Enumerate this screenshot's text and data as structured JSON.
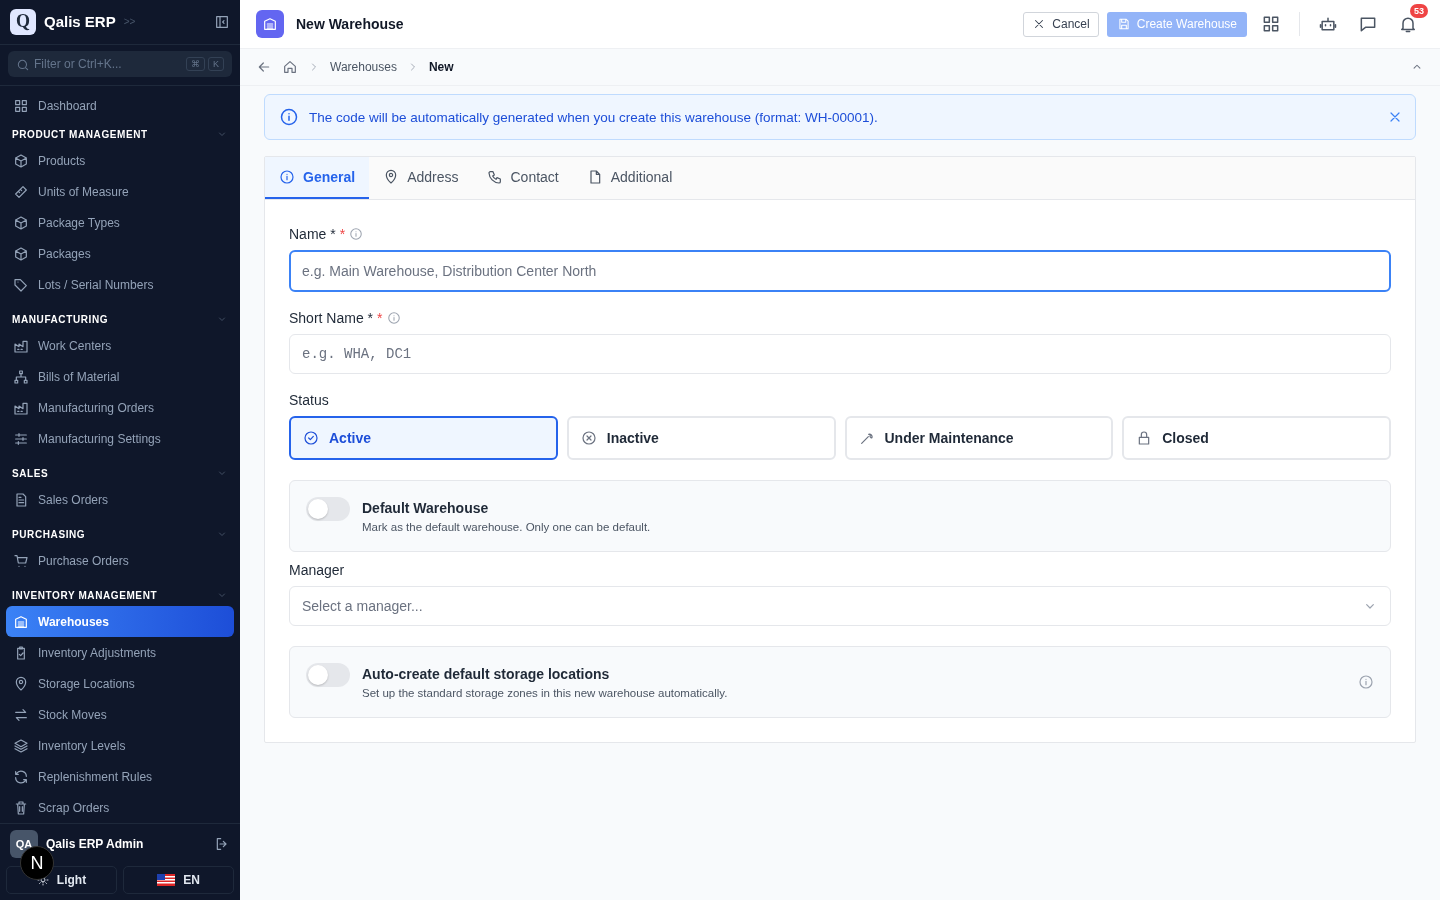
{
  "sidebar": {
    "brand": {
      "logo": "Q",
      "name": "Qalis ERP",
      "expand": ">>"
    },
    "search": {
      "placeholder": "Filter or Ctrl+K...",
      "keys": [
        "⌘",
        "K"
      ]
    },
    "top_item": {
      "label": "Dashboard",
      "selected": false
    },
    "sections": [
      {
        "title": "PRODUCT MANAGEMENT",
        "expanded": true,
        "items": [
          {
            "label": "Products",
            "selected": false
          },
          {
            "label": "Units of Measure",
            "selected": false
          },
          {
            "label": "Package Types",
            "selected": false
          },
          {
            "label": "Packages",
            "selected": false
          },
          {
            "label": "Lots / Serial Numbers",
            "selected": false
          }
        ]
      },
      {
        "title": "MANUFACTURING",
        "expanded": true,
        "items": [
          {
            "label": "Work Centers",
            "selected": false
          },
          {
            "label": "Bills of Material",
            "selected": false
          },
          {
            "label": "Manufacturing Orders",
            "selected": false
          },
          {
            "label": "Manufacturing Settings",
            "selected": false
          }
        ]
      },
      {
        "title": "SALES",
        "expanded": true,
        "items": [
          {
            "label": "Sales Orders",
            "selected": false
          }
        ]
      },
      {
        "title": "PURCHASING",
        "expanded": true,
        "items": [
          {
            "label": "Purchase Orders",
            "selected": false
          }
        ]
      },
      {
        "title": "INVENTORY MANAGEMENT",
        "expanded": true,
        "items": [
          {
            "label": "Warehouses",
            "selected": true
          },
          {
            "label": "Inventory Adjustments",
            "selected": false
          },
          {
            "label": "Storage Locations",
            "selected": false
          },
          {
            "label": "Stock Moves",
            "selected": false
          },
          {
            "label": "Inventory Levels",
            "selected": false
          },
          {
            "label": "Replenishment Rules",
            "selected": false
          },
          {
            "label": "Scrap Orders",
            "selected": false
          }
        ]
      }
    ],
    "user": {
      "initials": "QA",
      "name": "Qalis ERP Admin"
    },
    "dev_badge": "N",
    "theme_button": "Light",
    "language_button": "EN"
  },
  "header": {
    "title": "New Warehouse",
    "cancel": "Cancel",
    "create": {
      "label": "Create Warehouse",
      "disabled": true
    },
    "notifications": "53"
  },
  "breadcrumb": [
    "Warehouses",
    "New"
  ],
  "alert": "The code will be automatically generated when you create this warehouse (format: WH-00001).",
  "tabs": [
    {
      "label": "General",
      "selected": true
    },
    {
      "label": "Address",
      "selected": false
    },
    {
      "label": "Contact",
      "selected": false
    },
    {
      "label": "Additional",
      "selected": false
    }
  ],
  "form": {
    "name": {
      "label": "Name *",
      "required_mark": "*",
      "placeholder": "e.g. Main Warehouse, Distribution Center North",
      "focused": true
    },
    "short_name": {
      "label": "Short Name *",
      "required_mark": "*",
      "placeholder": "e.g. WHA, DC1",
      "focused": false
    },
    "status": {
      "label": "Status",
      "options": [
        {
          "label": "Active",
          "selected": true
        },
        {
          "label": "Inactive",
          "selected": false
        },
        {
          "label": "Under Maintenance",
          "selected": false
        },
        {
          "label": "Closed",
          "selected": false
        }
      ]
    },
    "default_toggle": {
      "title": "Default Warehouse",
      "description": "Mark as the default warehouse. Only one can be default.",
      "on": false
    },
    "manager": {
      "label": "Manager",
      "placeholder": "Select a manager..."
    },
    "auto_toggle": {
      "title": "Auto-create default storage locations",
      "description": "Set up the standard storage zones in this new warehouse automatically.",
      "on": false
    }
  }
}
